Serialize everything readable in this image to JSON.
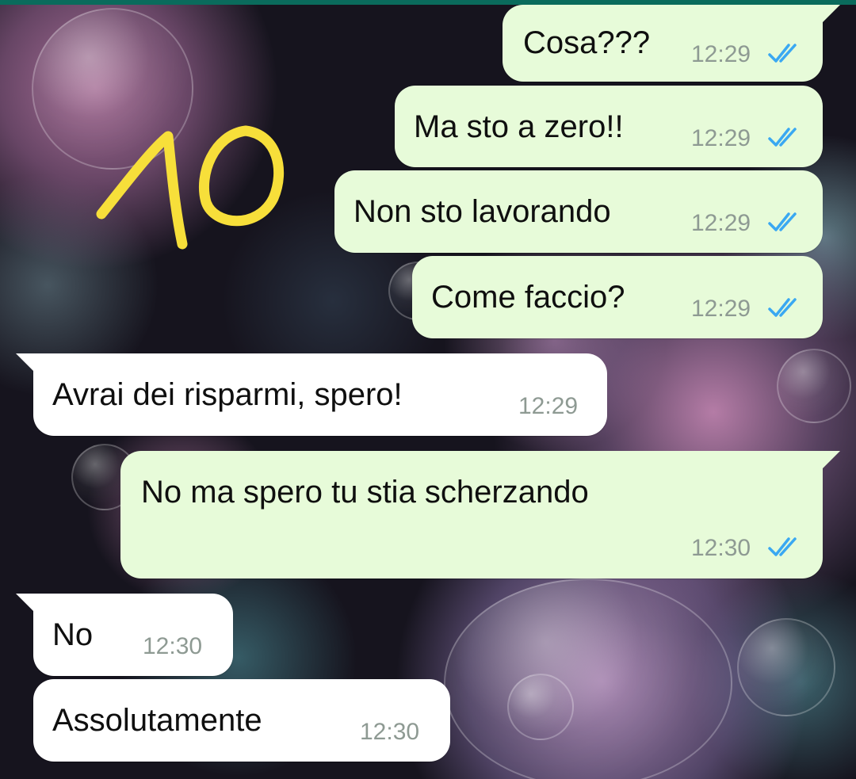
{
  "messages": [
    {
      "direction": "out",
      "text": "Cosa???",
      "time": "12:29",
      "status": "read"
    },
    {
      "direction": "out",
      "text": "Ma sto a zero!!",
      "time": "12:29",
      "status": "read"
    },
    {
      "direction": "out",
      "text": "Non sto lavorando",
      "time": "12:29",
      "status": "read"
    },
    {
      "direction": "out",
      "text": "Come faccio?",
      "time": "12:29",
      "status": "read"
    },
    {
      "direction": "in",
      "text": "Avrai dei risparmi, spero!",
      "time": "12:29"
    },
    {
      "direction": "out",
      "text": "No ma spero tu stia scherzando",
      "time": "12:30",
      "status": "read"
    },
    {
      "direction": "in",
      "text": "No",
      "time": "12:30"
    },
    {
      "direction": "in",
      "text": "Assolutamente",
      "time": "12:30"
    }
  ],
  "annotation": {
    "text": "10",
    "color": "#f7df3a"
  },
  "colors": {
    "outgoing_bubble": "#e7fbd9",
    "incoming_bubble": "#ffffff",
    "read_ticks": "#3aa8f2",
    "header_accent": "#0a6b5c",
    "timestamp": "#8e9a93"
  },
  "icons": {
    "read_receipt": "double-check-icon"
  }
}
